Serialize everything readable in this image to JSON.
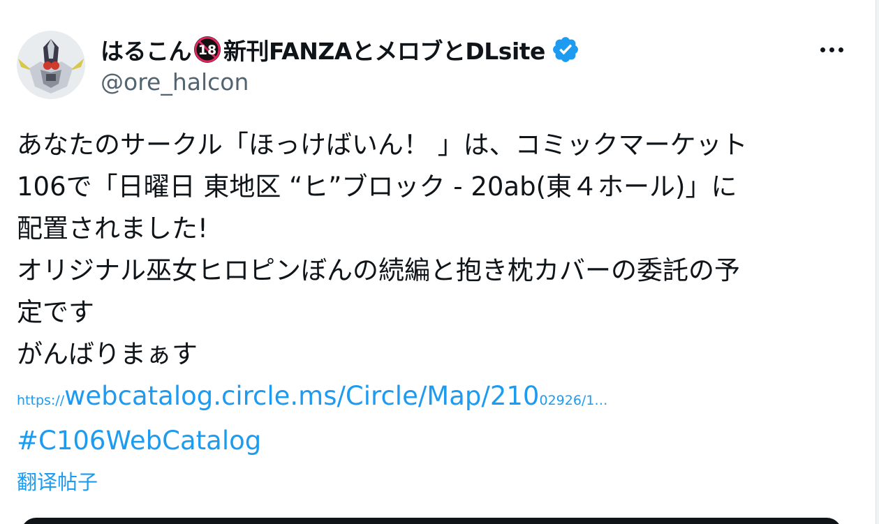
{
  "author": {
    "name_before_badge": "はるこん",
    "badge_icon": "r18-prohibited-icon",
    "name_after_badge": "新刊FANZAとメロブとDLsite",
    "verified_icon": "verified-badge-icon",
    "handle": "@ore_halcon",
    "avatar_icon": "robot-avatar"
  },
  "more_icon": "more-options-icon",
  "tweet": {
    "lines": [
      "あなたのサークル「ほっけばいん！ 」は、コミックマーケット",
      "106で「日曜日 東地区 “ヒ”ブロック - 20ab(東４ホール)」に",
      "配置されました!",
      "オリジナル巫女ヒロピンぼんの続編と抱き枕カバーの委託の予",
      "定です",
      "がんばりまぁす"
    ],
    "link": {
      "protocol": "https://",
      "main": "webcatalog.circle.ms/Circle/Map/210",
      "tail": "02926/1…"
    },
    "hashtag": "#C106WebCatalog"
  },
  "translate_label": "翻译帖子",
  "colors": {
    "link": "#1d9bf0",
    "text": "#0f1419",
    "muted": "#536471"
  }
}
